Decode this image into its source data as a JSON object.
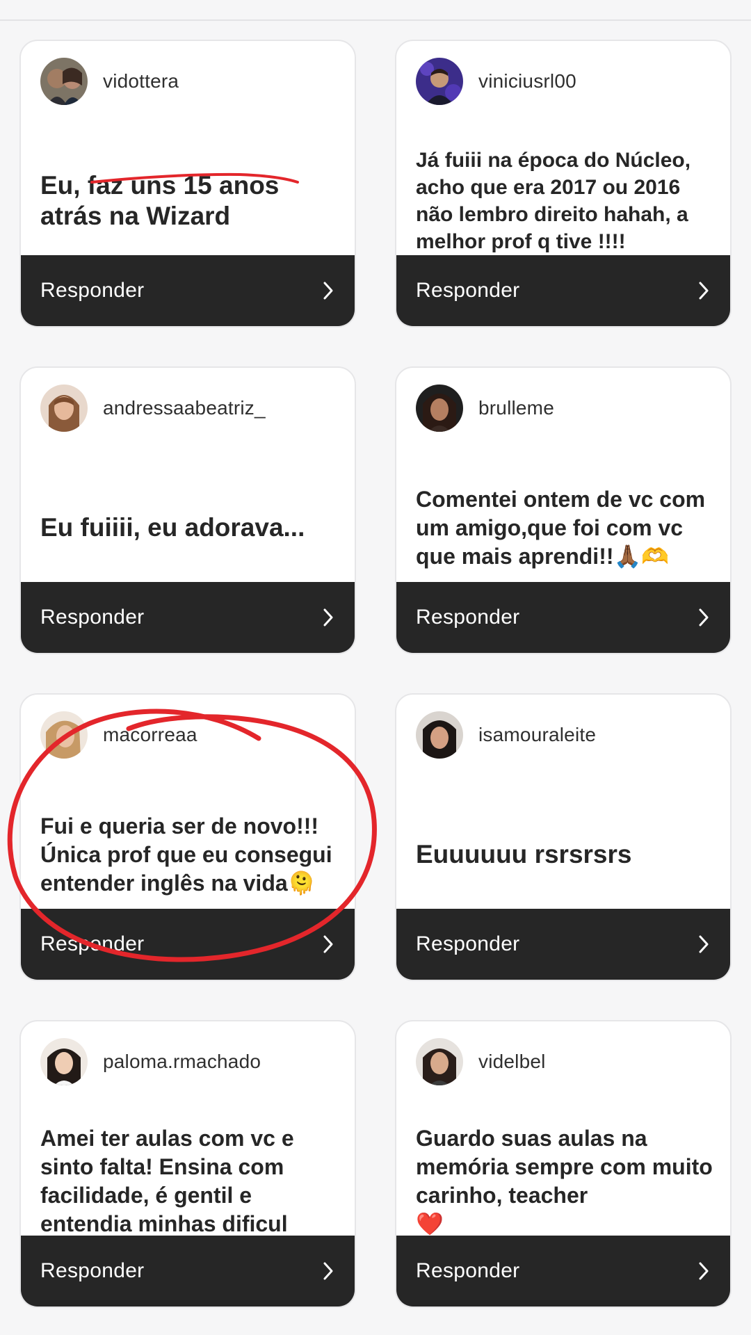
{
  "comments": [
    {
      "username": "vidottera",
      "text": "Eu, faz uns 15 anos atrás na Wizard",
      "reply": "Responder"
    },
    {
      "username": "viniciusrl00",
      "text": "Já fuiii na época do Núcleo, acho que era 2017 ou 2016 não lembro direito hahah, a melhor prof q tive !!!!",
      "reply": "Responder"
    },
    {
      "username": "andressaabeatriz_",
      "text": "Eu fuiiii, eu adorava...",
      "reply": "Responder"
    },
    {
      "username": "brulleme",
      "text": "Comentei ontem de vc com um amigo,que foi com vc que mais aprendi!!",
      "emoji": "🙏🏾🫶",
      "reply": "Responder"
    },
    {
      "username": "macorreaa",
      "text": "Fui e queria ser de novo!!! Única prof que eu consegui entender inglês na vida",
      "emoji": "🫠",
      "reply": "Responder"
    },
    {
      "username": "isamouraleite",
      "text": "Euuuuuu rsrsrsrs",
      "reply": "Responder"
    },
    {
      "username": "paloma.rmachado",
      "text": "Amei ter aulas com vc e sinto falta! Ensina com facilidade, é gentil e entendia minhas dificul",
      "reply": "Responder"
    },
    {
      "username": "videlbel",
      "text": "Guardo suas aulas na memória sempre com muito carinho, teacher",
      "emoji": "❤️",
      "reply": "Responder"
    }
  ],
  "colors": {
    "background": "#f6f6f7",
    "card": "#ffffff",
    "reply_bar": "#262626",
    "annotation": "#e3262b"
  }
}
